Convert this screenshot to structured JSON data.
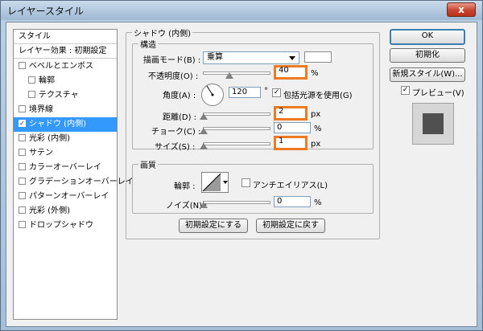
{
  "window": {
    "title": "レイヤースタイル",
    "close": "x"
  },
  "stylelist": {
    "items": [
      {
        "label": "スタイル",
        "checked": null
      },
      {
        "label": "レイヤー効果 : 初期設定",
        "checked": null
      },
      {
        "label": "ベベルとエンボス",
        "checked": false
      },
      {
        "label": "輪郭",
        "checked": false
      },
      {
        "label": "テクスチャ",
        "checked": false
      },
      {
        "label": "境界線",
        "checked": false
      },
      {
        "label": "シャドウ (内側)",
        "checked": true
      },
      {
        "label": "光彩 (内側)",
        "checked": false
      },
      {
        "label": "サテン",
        "checked": false
      },
      {
        "label": "カラーオーバーレイ",
        "checked": false
      },
      {
        "label": "グラデーションオーバーレイ",
        "checked": false
      },
      {
        "label": "パターンオーバーレイ",
        "checked": false
      },
      {
        "label": "光彩 (外側)",
        "checked": false
      },
      {
        "label": "ドロップシャドウ",
        "checked": false
      }
    ],
    "check_mark": "✓"
  },
  "shadow": {
    "group_title": "シャドウ (内側)",
    "structure_title": "構造",
    "blend_label": "描画モード(B) :",
    "blend_value": "乗算",
    "opacity_label": "不透明度(O) :",
    "opacity_value": "40",
    "opacity_unit": "%",
    "opacity_level": 0.4,
    "angle_label": "角度(A) :",
    "angle_value": "120",
    "angle_unit": "°",
    "global_light_label": "包括光源を使用(G)",
    "global_light_checked": true,
    "distance_label": "距離(D) :",
    "distance_value": "2",
    "distance_unit": "px",
    "choke_label": "チョーク(C) :",
    "choke_value": "0",
    "choke_unit": "%",
    "size_label": "サイズ(S) :",
    "size_value": "1",
    "size_unit": "px",
    "quality_title": "画質",
    "contour_label": "輪郭 :",
    "antialias_label": "アンチエイリアス(L)",
    "noise_label": "ノイズ(N) :",
    "noise_value": "0",
    "noise_unit": "%",
    "make_default": "初期設定にする",
    "reset_default": "初期設定に戻す"
  },
  "actions": {
    "ok": "OK",
    "reset": "初期化",
    "new_style": "新規スタイル(W)...",
    "preview": "プレビュー(V)",
    "preview_checked": true
  }
}
